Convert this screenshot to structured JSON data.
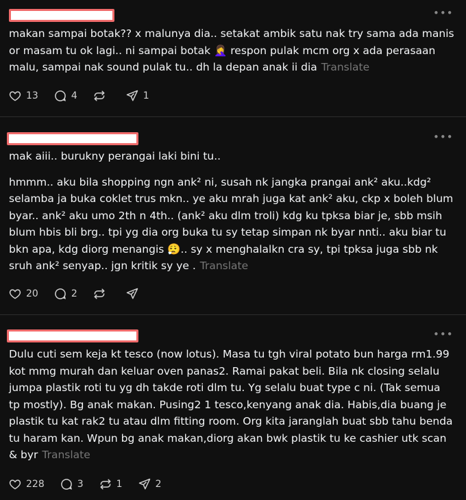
{
  "comments": [
    {
      "paragraphs": [
        "makan sampai botak?? x malunya dia.. setakat ambik satu nak try sama ada manis or masam tu ok lagi.. ni sampai botak 🤦‍♀️ respon pulak mcm org x ada perasaan malu, sampai nak sound pulak tu.. dh la depan anak ii dia"
      ],
      "translate": "Translate",
      "likes": "13",
      "replies": "4",
      "reposts": "",
      "shares": "1"
    },
    {
      "paragraphs": [
        "mak aiii.. burukny perangai laki bini tu..",
        "hmmm.. aku bila shopping ngn ank² ni, susah nk jangka prangai ank² aku..kdg² selamba ja buka coklet trus mkn.. ye aku mrah juga kat ank² aku, ckp x boleh blum byar.. ank² aku umo 2th n 4th.. (ank² aku dlm troli) kdg ku tpksa biar je, sbb msih blum hbis bli brg.. tpi yg dia org buka tu sy tetap simpan nk byar nnti.. aku biar tu bkn apa, kdg diorg menangis 😮‍💨.. sy x menghalalkn cra sy, tpi tpksa juga sbb nk sruh ank² senyap.. jgn kritik sy ye ."
      ],
      "translate": "Translate",
      "likes": "20",
      "replies": "2",
      "reposts": "",
      "shares": ""
    },
    {
      "paragraphs": [
        "Dulu cuti sem keja kt tesco (now lotus). Masa tu tgh viral potato bun harga rm1.99 kot mmg murah dan keluar oven panas2. Ramai pakat beli. Bila nk closing selalu jumpa plastik roti tu yg dh takde roti dlm tu. Yg selalu buat type c ni. (Tak semua tp mostly). Bg anak makan. Pusing2 1 tesco,kenyang anak dia. Habis,dia buang je plastik tu kat rak2 tu atau dlm fitting room. Org kita jaranglah buat sbb tahu benda tu haram kan. Wpun bg anak makan,diorg akan bwk plastik tu ke cashier utk scan & byr"
      ],
      "translate": "Translate",
      "likes": "228",
      "replies": "3",
      "reposts": "1",
      "shares": "2"
    }
  ],
  "icons": {
    "more": "more-icon",
    "like": "heart-icon",
    "reply": "comment-icon",
    "repost": "repost-icon",
    "share": "share-icon"
  },
  "colors": {
    "background": "#101010",
    "text": "#f3f5f7",
    "muted": "#777777",
    "redaction_fill": "#ffffff",
    "redaction_border": "#f06b6b"
  }
}
